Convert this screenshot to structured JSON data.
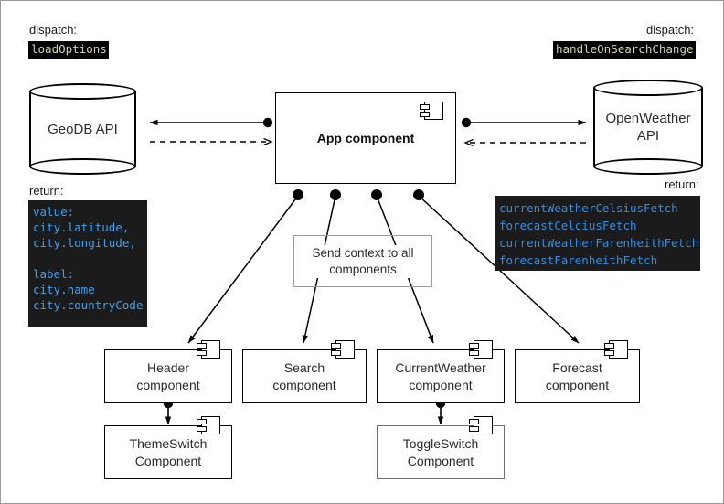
{
  "diagram": {
    "title": "Weather App component architecture diagram",
    "colors": {
      "chip_bg": "#000000",
      "chip_text": "#d6d6a0",
      "code_bg": "#1b1b1b",
      "code_text": "#3fa0f0",
      "line": "#000000",
      "note_border": "#9a9a9a"
    },
    "labels": {
      "dispatch_left_caption": "dispatch:",
      "dispatch_left_value": "loadOptions",
      "dispatch_right_caption": "dispatch:",
      "dispatch_right_value": "handleOnSearchChange",
      "return_left_caption": "return:",
      "return_right_caption": "return:"
    },
    "return_left_code": "value:\ncity.latitude,\ncity.longitude,\n\nlabel:\ncity.name\ncity.countryCode",
    "return_right_code": "currentWeatherCelsiusFetch\nforecastCelciusFetch\ncurrentWeatherFarenheithFetch\nforecastFarenheithFetch",
    "datastores": [
      {
        "id": "geodb",
        "label": "GeoDB API"
      },
      {
        "id": "openweather",
        "label": "OpenWeather\nAPI",
        "line1": "OpenWeather",
        "line2": "API"
      }
    ],
    "app": {
      "label": "App component"
    },
    "note": {
      "line1": "Send context to all",
      "line2": "components"
    },
    "components": [
      {
        "id": "header",
        "line1": "Header",
        "line2": "component"
      },
      {
        "id": "search",
        "line1": "Search",
        "line2": "component"
      },
      {
        "id": "currentweather",
        "line1": "CurrentWeather",
        "line2": "component"
      },
      {
        "id": "forecast",
        "line1": "Forecast",
        "line2": "component"
      }
    ],
    "subcomponents": [
      {
        "id": "themeswitch",
        "line1": "ThemeSwitch",
        "line2": "Component"
      },
      {
        "id": "toggleswitch",
        "line1": "ToggleSwitch",
        "line2": "Component"
      }
    ]
  }
}
